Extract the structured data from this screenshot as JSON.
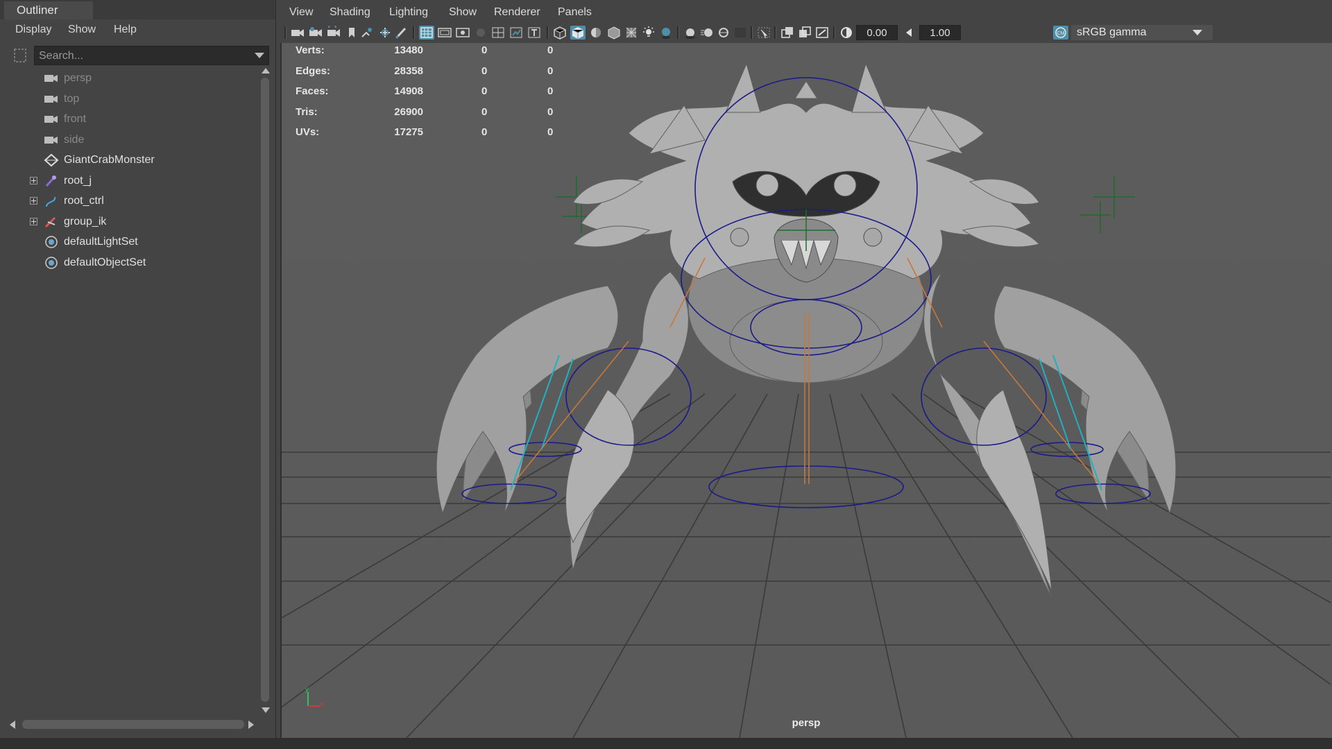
{
  "outliner": {
    "tab_title": "Outliner",
    "menu": [
      "Display",
      "Show",
      "Help"
    ],
    "search": {
      "placeholder": "Search..."
    },
    "items": [
      {
        "label": "persp",
        "icon": "camera-icon",
        "dim": true,
        "expandable": false
      },
      {
        "label": "top",
        "icon": "camera-icon",
        "dim": true,
        "expandable": false
      },
      {
        "label": "front",
        "icon": "camera-icon",
        "dim": true,
        "expandable": false
      },
      {
        "label": "side",
        "icon": "camera-icon",
        "dim": true,
        "expandable": false
      },
      {
        "label": "GiantCrabMonster",
        "icon": "mesh-transform-icon",
        "dim": false,
        "expandable": false
      },
      {
        "label": "root_j",
        "icon": "joint-icon",
        "dim": false,
        "expandable": true
      },
      {
        "label": "root_ctrl",
        "icon": "curve-icon",
        "dim": false,
        "expandable": true
      },
      {
        "label": "group_ik",
        "icon": "ik-handle-icon",
        "dim": false,
        "expandable": true
      },
      {
        "label": "defaultLightSet",
        "icon": "set-icon",
        "dim": false,
        "expandable": false
      },
      {
        "label": "defaultObjectSet",
        "icon": "set-icon",
        "dim": false,
        "expandable": false
      }
    ]
  },
  "viewport": {
    "menu": [
      "View",
      "Shading",
      "Lighting",
      "Show",
      "Renderer",
      "Panels"
    ],
    "toolbar": {
      "exposure": "0.00",
      "gamma": "1.00",
      "color_space": "sRGB gamma"
    },
    "camera_name": "persp",
    "hud": [
      {
        "label": "Verts:",
        "v1": "13480",
        "v2": "0",
        "v3": "0"
      },
      {
        "label": "Edges:",
        "v1": "28358",
        "v2": "0",
        "v3": "0"
      },
      {
        "label": "Faces:",
        "v1": "14908",
        "v2": "0",
        "v3": "0"
      },
      {
        "label": "Tris:",
        "v1": "26900",
        "v2": "0",
        "v3": "0"
      },
      {
        "label": "UVs:",
        "v1": "17275",
        "v2": "0",
        "v3": "0"
      }
    ],
    "axis": {
      "y": "y",
      "x": "x"
    }
  },
  "colors": {
    "accent": "#4f8ea8",
    "ctrl_curve": "#1a1a8a",
    "joint": "#c8783a",
    "ik": "#22b0c0",
    "locator": "#1f6a2f"
  }
}
